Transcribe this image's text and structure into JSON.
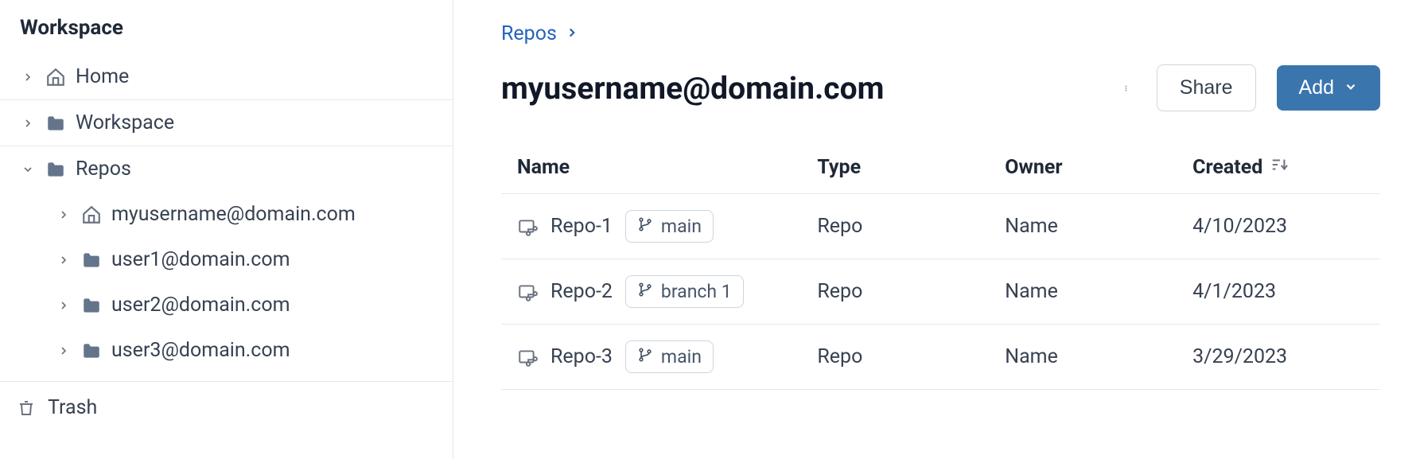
{
  "sidebar": {
    "title": "Workspace",
    "home_label": "Home",
    "workspace_label": "Workspace",
    "repos_label": "Repos",
    "children": [
      {
        "label": "myusername@domain.com",
        "icon": "home"
      },
      {
        "label": "user1@domain.com",
        "icon": "folder"
      },
      {
        "label": "user2@domain.com",
        "icon": "folder"
      },
      {
        "label": "user3@domain.com",
        "icon": "folder"
      }
    ],
    "trash_label": "Trash"
  },
  "breadcrumb": {
    "root": "Repos"
  },
  "page": {
    "title": "myusername@domain.com"
  },
  "actions": {
    "share_label": "Share",
    "add_label": "Add"
  },
  "table": {
    "columns": {
      "name": "Name",
      "type": "Type",
      "owner": "Owner",
      "created": "Created"
    },
    "rows": [
      {
        "name": "Repo-1",
        "branch": "main",
        "type": "Repo",
        "owner": "Name",
        "created": "4/10/2023"
      },
      {
        "name": "Repo-2",
        "branch": "branch 1",
        "type": "Repo",
        "owner": "Name",
        "created": "4/1/2023"
      },
      {
        "name": "Repo-3",
        "branch": "main",
        "type": "Repo",
        "owner": "Name",
        "created": "3/29/2023"
      }
    ]
  }
}
